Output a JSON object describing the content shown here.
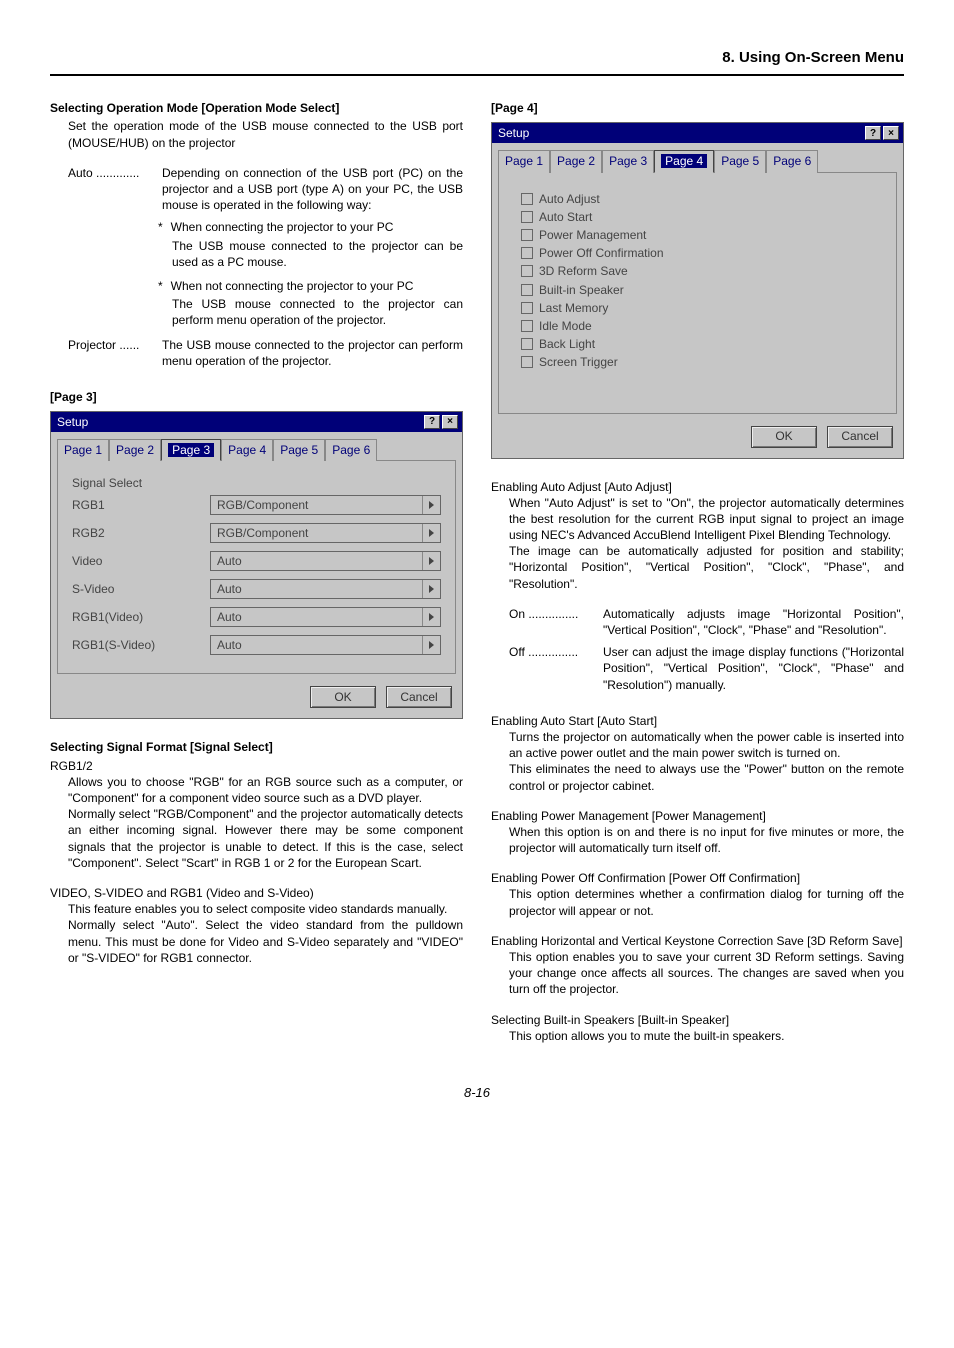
{
  "header": {
    "title": "8. Using On-Screen Menu"
  },
  "left": {
    "h1": "Selecting Operation Mode [Operation Mode Select]",
    "p1": "Set the operation mode of the USB mouse connected to the USB port (MOUSE/HUB) on the projector",
    "auto_term": "Auto .............",
    "auto_body": "Depending on connection of the USB port (PC) on the projector and a USB port (type A) on your PC, the USB mouse is operated in the following way:",
    "b1": "When connecting the projector to your PC",
    "b1b": "The USB mouse connected to the projector can be used as a PC mouse.",
    "b2": "When not connecting the projector to your PC",
    "b2b": "The USB mouse connected to the projector can perform menu operation of the projector.",
    "proj_term": "Projector ......",
    "proj_body": "The USB mouse connected to the projector can perform menu operation of the projector.",
    "page3_label": "[Page 3]",
    "h2": "Selecting Signal Format [Signal Select]",
    "h2sub": "RGB1/2",
    "p2": "Allows you to choose \"RGB\" for an RGB source such as a computer, or \"Component\" for a component video source such as a DVD player.",
    "p3": "Normally select \"RGB/Component\" and the projector automatically detects an either incoming signal. However there may be some component signals that the projector is unable to detect. If this is the case, select \"Component\". Select \"Scart\" in RGB 1 or 2 for the European Scart.",
    "h3": "VIDEO, S-VIDEO and RGB1 (Video and S-Video)",
    "p4": "This feature enables you to select composite video standards manually.",
    "p5": "Normally select \"Auto\". Select the video standard from the pulldown menu. This must be done for Video and S-Video separately and \"VIDEO\" or \"S-VIDEO\" for RGB1 connector."
  },
  "right": {
    "page4_label": "[Page 4]",
    "h1": "Enabling Auto Adjust [Auto Adjust]",
    "p1": "When \"Auto Adjust\" is set to \"On\", the projector automatically determines the best resolution for the current RGB input signal to project an image using NEC's Advanced AccuBlend Intelligent Pixel Blending Technology.",
    "p1b": "The image can be automatically adjusted for position and stability; \"Horizontal Position\", \"Vertical Position\", \"Clock\", \"Phase\", and \"Resolution\".",
    "on_term": "On ...............",
    "on_body": "Automatically adjusts image \"Horizontal Position\", \"Vertical Position\", \"Clock\", \"Phase\" and \"Resolution\".",
    "off_term": "Off ...............",
    "off_body": "User can adjust the image display functions (\"Horizontal Position\", \"Vertical Position\", \"Clock\", \"Phase\" and \"Resolution\") manually.",
    "h2": "Enabling Auto Start [Auto Start]",
    "p2": "Turns the projector on automatically when the power cable is inserted into an active power outlet and the main power switch is turned on.",
    "p2b": "This eliminates the need to always use the \"Power\" button on the remote control or projector cabinet.",
    "h3": "Enabling Power Management [Power Management]",
    "p3": "When this option is on and there is no input for five minutes or more, the projector will automatically turn itself off.",
    "h4": "Enabling Power Off Confirmation [Power Off Confirmation]",
    "p4": "This option determines whether a confirmation dialog for turning off the projector will appear or not.",
    "h5": "Enabling Horizontal and Vertical Keystone Correction Save [3D Reform Save]",
    "p5": "This option enables you to save your current 3D Reform settings. Saving your change once affects all sources. The changes are saved when you turn off the projector.",
    "h6": "Selecting Built-in Speakers [Built-in Speaker]",
    "p6": "This option allows you to mute the built-in speakers."
  },
  "dialog3": {
    "title": "Setup",
    "tabs": [
      "Page 1",
      "Page 2",
      "Page 3",
      "Page 4",
      "Page 5",
      "Page 6"
    ],
    "active_tab": 2,
    "signal_label": "Signal Select",
    "rows": [
      {
        "label": "RGB1",
        "value": "RGB/Component"
      },
      {
        "label": "RGB2",
        "value": "RGB/Component"
      },
      {
        "label": "Video",
        "value": "Auto"
      },
      {
        "label": "S-Video",
        "value": "Auto"
      },
      {
        "label": "RGB1(Video)",
        "value": "Auto"
      },
      {
        "label": "RGB1(S-Video)",
        "value": "Auto"
      }
    ],
    "ok": "OK",
    "cancel": "Cancel"
  },
  "dialog4": {
    "title": "Setup",
    "tabs": [
      "Page 1",
      "Page 2",
      "Page 3",
      "Page 4",
      "Page 5",
      "Page 6"
    ],
    "active_tab": 3,
    "items": [
      "Auto Adjust",
      "Auto Start",
      "Power Management",
      "Power Off Confirmation",
      "3D Reform Save",
      "Built-in Speaker",
      "Last Memory",
      "Idle Mode",
      "Back Light",
      "Screen Trigger"
    ],
    "ok": "OK",
    "cancel": "Cancel"
  },
  "footer": {
    "page": "8-16"
  }
}
